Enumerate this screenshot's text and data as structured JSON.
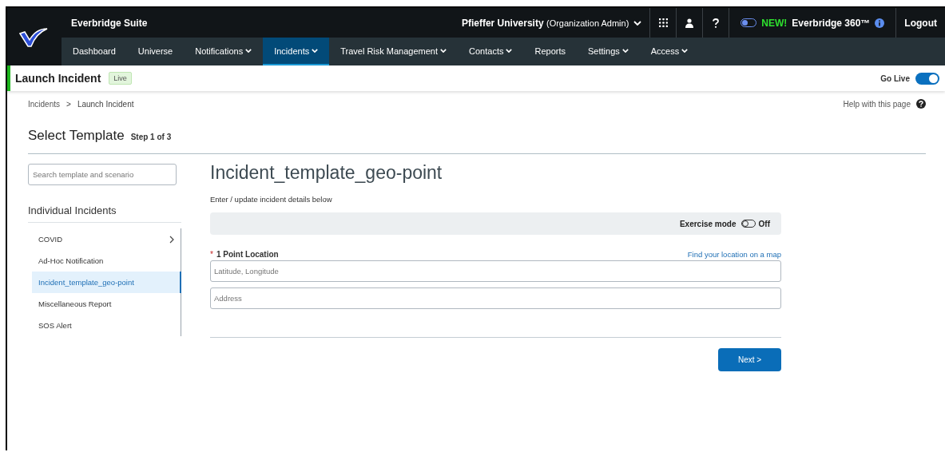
{
  "header": {
    "suite_title": "Everbridge Suite",
    "organization": "Pfieffer University",
    "role": "(Organization Admin)",
    "new_badge": "NEW!",
    "product_360": "Everbridge 360™",
    "product_360_toggle_on": false,
    "logout": "Logout"
  },
  "nav": [
    {
      "label": "Dashboard",
      "dropdown": false,
      "selected": false
    },
    {
      "label": "Universe",
      "dropdown": false,
      "selected": false
    },
    {
      "label": "Notifications",
      "dropdown": true,
      "selected": false
    },
    {
      "label": "Incidents",
      "dropdown": true,
      "selected": true
    },
    {
      "label": "Travel Risk Management",
      "dropdown": true,
      "selected": false
    },
    {
      "label": "Contacts",
      "dropdown": true,
      "selected": false
    },
    {
      "label": "Reports",
      "dropdown": false,
      "selected": false
    },
    {
      "label": "Settings",
      "dropdown": true,
      "selected": false
    },
    {
      "label": "Access",
      "dropdown": true,
      "selected": false
    }
  ],
  "page_bar": {
    "title": "Launch Incident",
    "status_badge": "Live",
    "go_live_label": "Go Live",
    "go_live_on": true
  },
  "breadcrumb": [
    "Incidents",
    ">",
    "Launch Incident"
  ],
  "help_link": "Help with this page",
  "page_heading": {
    "title": "Select Template",
    "step": "Step 1 of 3"
  },
  "sidebar": {
    "search": {
      "placeholder": "Search template and scenario"
    },
    "section_title": "Individual Incidents",
    "items": [
      {
        "label": "COVID",
        "has_children": true,
        "selected": false
      },
      {
        "label": "Ad-Hoc Notification",
        "has_children": false,
        "selected": false
      },
      {
        "label": "Incident_template_geo-point",
        "has_children": false,
        "selected": true
      },
      {
        "label": "Miscellaneous Report",
        "has_children": false,
        "selected": false
      },
      {
        "label": "SOS Alert",
        "has_children": false,
        "selected": false
      }
    ]
  },
  "form": {
    "title": "Incident_template_geo-point",
    "subtitle": "Enter / update incident details below",
    "exercise_mode_label": "Exercise mode",
    "exercise_mode_on": false,
    "exercise_mode_state": "Off",
    "field_label": "1 Point Location",
    "required_mark": "*",
    "map_link": "Find your location on a map",
    "fields": [
      {
        "placeholder": "Latitude, Longitude"
      },
      {
        "placeholder": "Address"
      }
    ],
    "next_button": "Next >"
  }
}
